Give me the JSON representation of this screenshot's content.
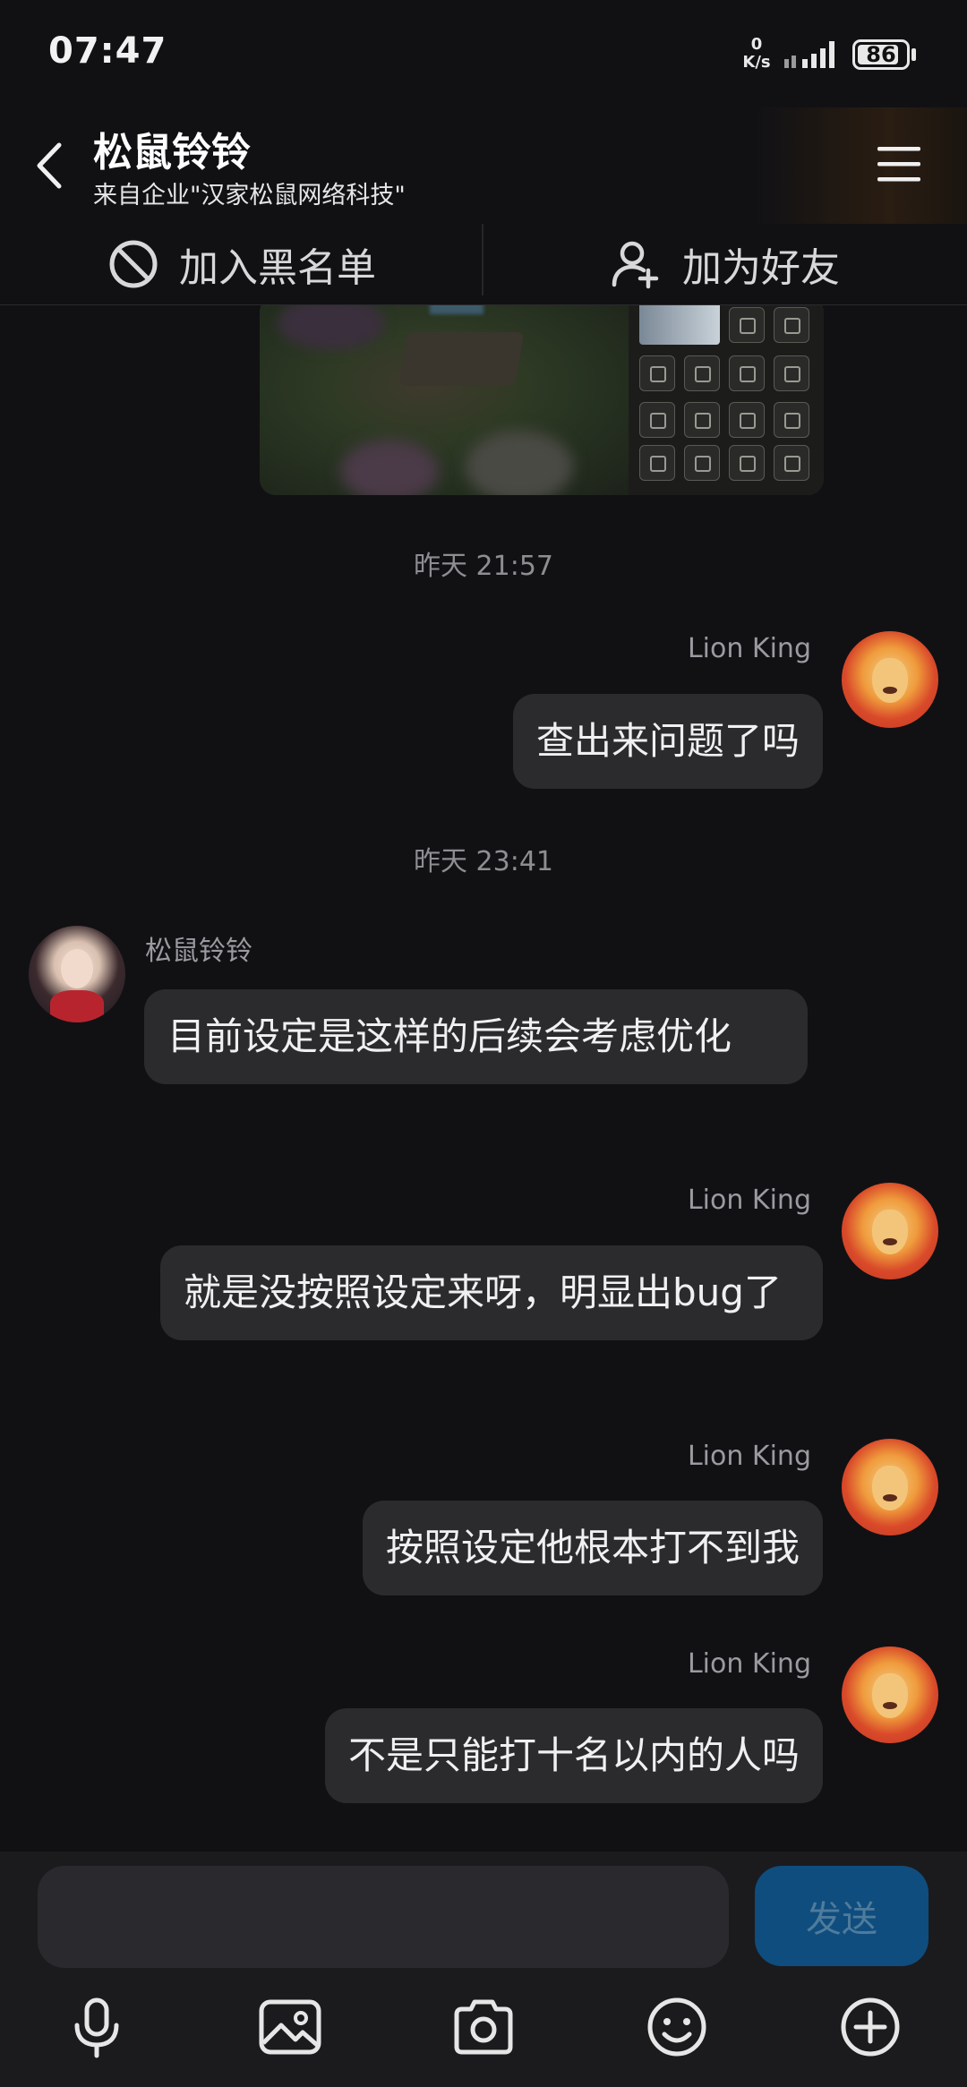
{
  "status_bar": {
    "time": "07:47",
    "net_speed_value": "0",
    "net_speed_unit": "K/s",
    "battery": "86",
    "battery_level": 0.86
  },
  "header": {
    "title": "松鼠铃铃",
    "subtitle": "来自企业\"汉家松鼠网络科技\"",
    "back_icon": "chevron-left-icon",
    "menu_icon": "hamburger-menu-icon"
  },
  "actions": {
    "block_label": "加入黑名单",
    "block_icon": "block-icon",
    "add_friend_label": "加为好友",
    "add_friend_icon": "add-user-icon"
  },
  "messages": [
    {
      "type": "timestamp",
      "text": "昨天 21:57"
    },
    {
      "type": "outgoing",
      "sender": "Lion King",
      "text": "查出来问题了吗"
    },
    {
      "type": "timestamp",
      "text": "昨天 23:41"
    },
    {
      "type": "incoming",
      "sender": "松鼠铃铃",
      "text": "目前设定是这样的后续会考虑优化"
    },
    {
      "type": "outgoing",
      "sender": "Lion King",
      "text": "就是没按照设定来呀，明显出bug了"
    },
    {
      "type": "outgoing",
      "sender": "Lion King",
      "text": "按照设定他根本打不到我"
    },
    {
      "type": "outgoing",
      "sender": "Lion King",
      "text": "不是只能打十名以内的人吗"
    }
  ],
  "input": {
    "placeholder": "",
    "send_label": "发送"
  },
  "toolbar": [
    "microphone-icon",
    "image-icon",
    "camera-icon",
    "emoji-icon",
    "plus-circle-icon"
  ],
  "colors": {
    "background": "#111114",
    "bubble": "#2b2b2e",
    "send_button": "#0f4d7e",
    "send_text": "#4f7b9c"
  }
}
